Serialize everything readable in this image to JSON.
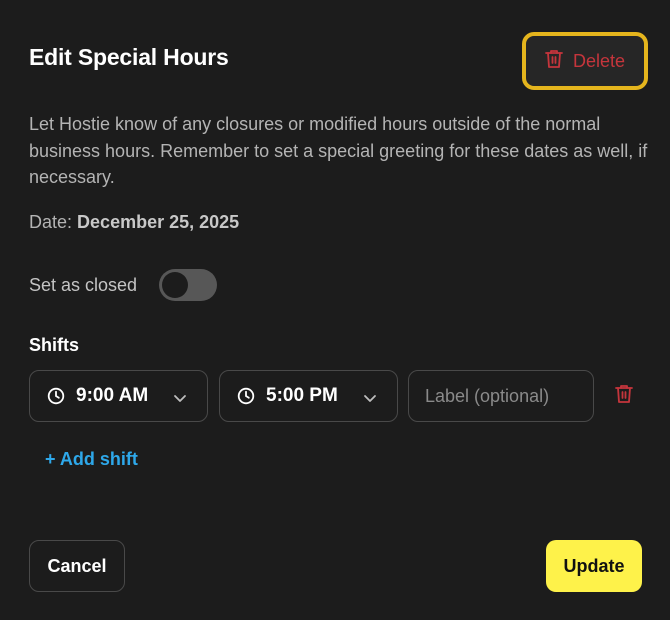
{
  "dialog": {
    "title": "Edit Special Hours",
    "delete_label": "Delete",
    "description": "Let Hostie know of any closures or modified hours outside of the normal business hours. Remember to set a special greeting for these dates as well, if necessary.",
    "date_label": "Date:",
    "date_value": "December 25, 2025",
    "closed_label": "Set as closed",
    "closed_toggle_on": false
  },
  "shifts": {
    "title": "Shifts",
    "items": [
      {
        "start": "9:00 AM",
        "end": "5:00 PM",
        "label_value": "",
        "label_placeholder": "Label (optional)"
      }
    ],
    "add_label": "+ Add shift"
  },
  "footer": {
    "cancel_label": "Cancel",
    "update_label": "Update"
  },
  "colors": {
    "background": "#1c1c1c",
    "danger": "#c5353c",
    "highlight": "#e5b51d",
    "link": "#2ea8ea",
    "primary": "#fef24a"
  },
  "icons": [
    "trash-icon",
    "clock-icon",
    "chevron-down-icon"
  ]
}
